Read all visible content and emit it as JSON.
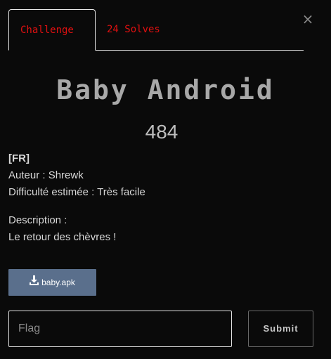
{
  "modal": {
    "close_glyph": "×"
  },
  "tabs": [
    {
      "label": "Challenge",
      "active": true
    },
    {
      "label": "24 Solves",
      "active": false
    }
  ],
  "challenge": {
    "name": "Baby Android",
    "points": "484",
    "description": {
      "lang_tag": "[FR]",
      "author": "Auteur : Shrewk",
      "difficulty": "Difficulté estimée : Très facile",
      "desc_label": "Description :",
      "desc_text": "Le retour des chèvres !"
    },
    "file": {
      "label": "baby.apk",
      "icon": "download-icon"
    }
  },
  "form": {
    "flag_placeholder": "Flag",
    "flag_value": "",
    "submit_label": "Submit"
  },
  "colors": {
    "background": "#0a0a0a",
    "tab_text": "#e01010",
    "file_button": "#5a6f8c"
  }
}
